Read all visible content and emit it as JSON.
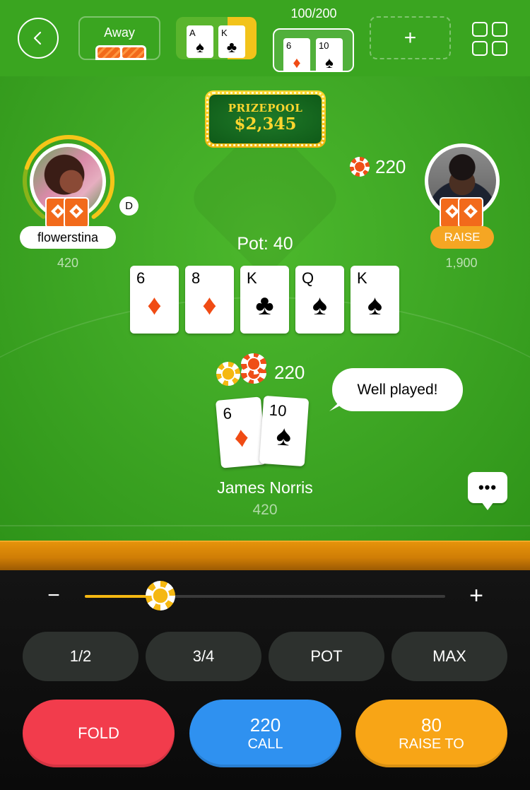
{
  "colors": {
    "felt": "#3fa825",
    "accent_orange": "#f26a1b",
    "gold": "#ffd62e",
    "fold": "#f23c4c",
    "call": "#2f91f0",
    "raise": "#f8a516"
  },
  "topbar": {
    "back_icon": "chevron-left-icon",
    "away_label": "Away",
    "seat_count": "100/200",
    "table_ak": {
      "cards": [
        {
          "rank": "A",
          "suit": "♠"
        },
        {
          "rank": "K",
          "suit": "♣"
        }
      ]
    },
    "table_current": {
      "cards": [
        {
          "rank": "6",
          "suit": "♦"
        },
        {
          "rank": "10",
          "suit": "♠"
        }
      ]
    },
    "add_label": "+",
    "menu_icon": "grid-icon"
  },
  "prizepool": {
    "title": "PRIZEPOOL",
    "amount": "$2,345"
  },
  "players": {
    "left": {
      "name": "flowerstina",
      "stack": "420",
      "dealer": "D",
      "timer_fraction": 0.75
    },
    "right": {
      "bet": "220",
      "action": "RAISE",
      "stack": "1,900"
    }
  },
  "pot": {
    "label": "Pot: 40"
  },
  "board": [
    {
      "rank": "6",
      "suit": "♦",
      "color": "red"
    },
    {
      "rank": "8",
      "suit": "♦",
      "color": "red"
    },
    {
      "rank": "K",
      "suit": "♣",
      "color": "black"
    },
    {
      "rank": "Q",
      "suit": "♠",
      "color": "black"
    },
    {
      "rank": "K",
      "suit": "♠",
      "color": "black"
    }
  ],
  "hero": {
    "bet": "220",
    "name": "James Norris",
    "stack": "420",
    "cards": [
      {
        "rank": "6",
        "suit": "♦"
      },
      {
        "rank": "10",
        "suit": "♠"
      }
    ]
  },
  "chat": {
    "bubble": "Well played!",
    "button": "•••"
  },
  "controls": {
    "minus": "−",
    "plus": "+",
    "slider_fraction": 0.21,
    "presets": [
      "1/2",
      "3/4",
      "POT",
      "MAX"
    ],
    "fold": "FOLD",
    "call_amount": "220",
    "call_label": "CALL",
    "raise_amount": "80",
    "raise_label": "RAISE TO"
  }
}
